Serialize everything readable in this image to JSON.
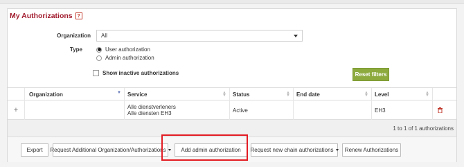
{
  "panel": {
    "title": "My Authorizations",
    "help_glyph": "?"
  },
  "filters": {
    "organization_label": "Organization",
    "organization_value": "All",
    "type_label": "Type",
    "type_options": [
      "User authorization",
      "Admin authorization"
    ],
    "type_selected": "User authorization",
    "show_inactive_label": "Show inactive authorizations",
    "show_inactive_checked": false,
    "reset_label": "Reset filters",
    "reset_color": "#8caa3e"
  },
  "table": {
    "columns": [
      "Organization",
      "Service",
      "Status",
      "End date",
      "Level"
    ],
    "rows": [
      {
        "expand_glyph": "+",
        "organization": "",
        "service_line1": "Alle dienstverleners",
        "service_line2": "Alle diensten EH3",
        "status": "Active",
        "end_date": "",
        "level": "EH3"
      }
    ],
    "summary": "1 to 1 of 1 authorizations"
  },
  "actions": {
    "export": "Export",
    "request_additional": "Request Additional Organization/Authorizations",
    "add_admin": "Add admin authorization",
    "request_chain": "Request new chain authorizations",
    "renew": "Renew Authorizations"
  },
  "colors": {
    "title": "#a21d2f",
    "highlight": "#e31b23",
    "delete_icon": "#c0392b"
  }
}
